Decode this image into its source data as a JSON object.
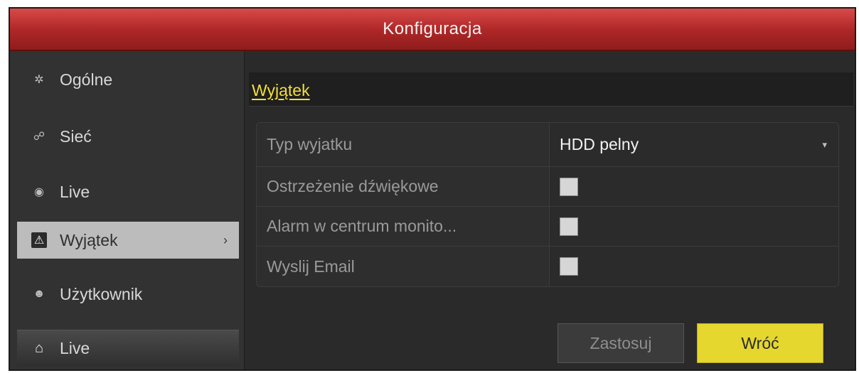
{
  "window": {
    "title": "Konfiguracja"
  },
  "sidebar": {
    "items": [
      {
        "label": "Ogólne",
        "icon": "gear-icon"
      },
      {
        "label": "Sieć",
        "icon": "network-icon"
      },
      {
        "label": "Live",
        "icon": "eye-icon"
      },
      {
        "label": "Wyjątek",
        "icon": "warning-icon",
        "active": true
      },
      {
        "label": "Użytkownik",
        "icon": "users-icon"
      }
    ],
    "bottom": {
      "label": "Live",
      "icon": "home-icon"
    }
  },
  "main": {
    "tab": "Wyjątek",
    "rows": [
      {
        "label": "Typ wyjatku",
        "value": "HDD pelny"
      },
      {
        "label": "Ostrzeżenie dźwiękowe",
        "checked": false
      },
      {
        "label": "Alarm w centrum monito...",
        "checked": false
      },
      {
        "label": "Wyslij Email",
        "checked": false
      }
    ],
    "buttons": {
      "apply": "Zastosuj",
      "back": "Wróć"
    }
  },
  "colors": {
    "title_bar": "#b02828",
    "accent": "#e6d72e",
    "active_item": "#bcbcbc"
  }
}
